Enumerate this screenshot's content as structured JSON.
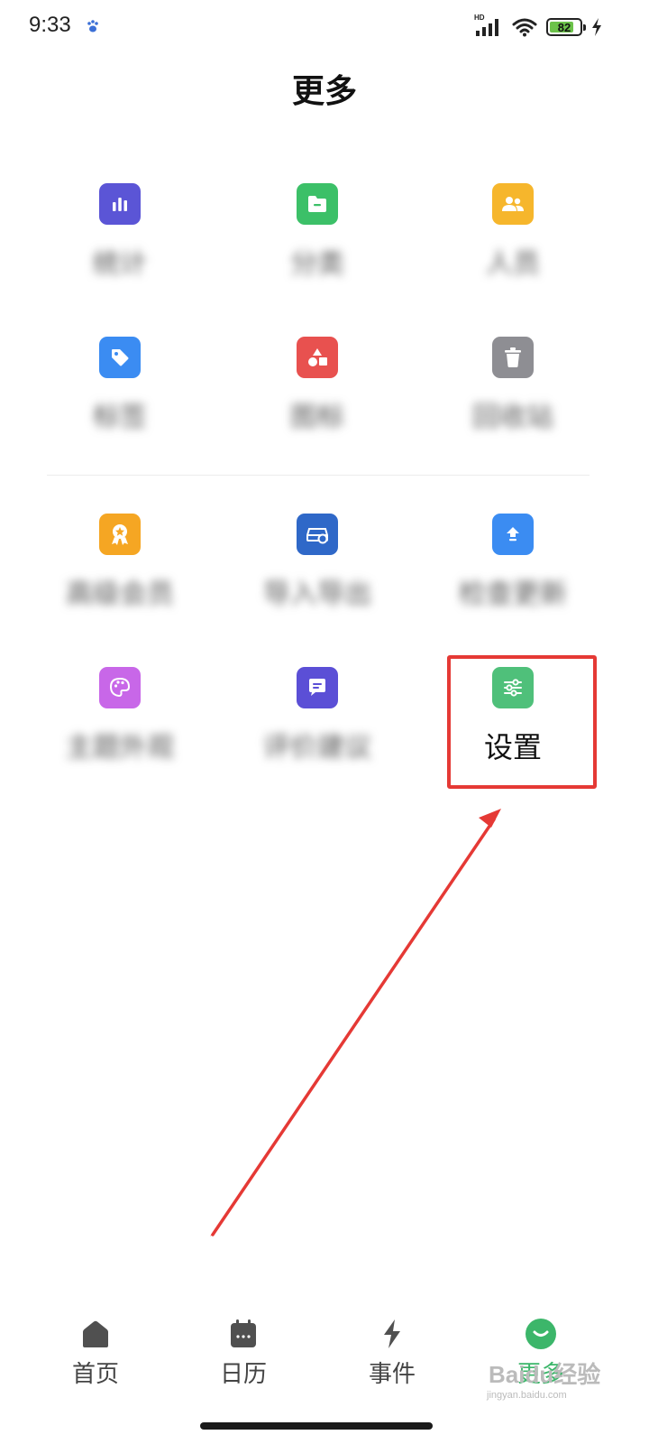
{
  "status_bar": {
    "time": "9:33",
    "network_label": "HD",
    "battery": "82",
    "battery_level": 0.82,
    "icons": [
      "baidu-paw-icon",
      "signal-icon",
      "wifi-icon",
      "battery-icon",
      "charging-bolt-icon"
    ]
  },
  "page": {
    "title": "更多"
  },
  "grid": {
    "items": [
      {
        "label": "统计",
        "icon": "bar-chart-icon",
        "color": "#5b55d6",
        "blurred": true
      },
      {
        "label": "分类",
        "icon": "folder-icon",
        "color": "#3cc068",
        "blurred": true
      },
      {
        "label": "人员",
        "icon": "people-icon",
        "color": "#f6b62c",
        "blurred": true
      },
      {
        "label": "标签",
        "icon": "tag-icon",
        "color": "#3b8cf2",
        "blurred": true
      },
      {
        "label": "图标",
        "icon": "shapes-icon",
        "color": "#e8514f",
        "blurred": true
      },
      {
        "label": "回收站",
        "icon": "trash-icon",
        "color": "#8e8e93",
        "blurred": true
      },
      {
        "label": "高级会员",
        "icon": "badge-icon",
        "color": "#f5a623",
        "blurred": true
      },
      {
        "label": "导入导出",
        "icon": "import-export-icon",
        "color": "#2f68c8",
        "blurred": true
      },
      {
        "label": "检查更新",
        "icon": "upload-icon",
        "color": "#3b8cf2",
        "blurred": true
      },
      {
        "label": "主题外观",
        "icon": "palette-icon",
        "color": "#c867e8",
        "blurred": true
      },
      {
        "label": "评价建议",
        "icon": "message-icon",
        "color": "#5b4fd6",
        "blurred": true
      },
      {
        "label": "设置",
        "icon": "sliders-icon",
        "color": "#4fc07a",
        "blurred": false
      }
    ]
  },
  "annotation": {
    "color": "#e53935",
    "target": "设置"
  },
  "bottom_nav": {
    "items": [
      {
        "label": "首页",
        "icon": "home-icon",
        "active": false
      },
      {
        "label": "日历",
        "icon": "calendar-icon",
        "active": false
      },
      {
        "label": "事件",
        "icon": "lightning-icon",
        "active": false
      },
      {
        "label": "更多",
        "icon": "more-smile-icon",
        "active": true
      }
    ],
    "active_color": "#3cb66a"
  },
  "watermark": {
    "text": "Baidu经验",
    "sub": "jingyan.baidu.com"
  }
}
